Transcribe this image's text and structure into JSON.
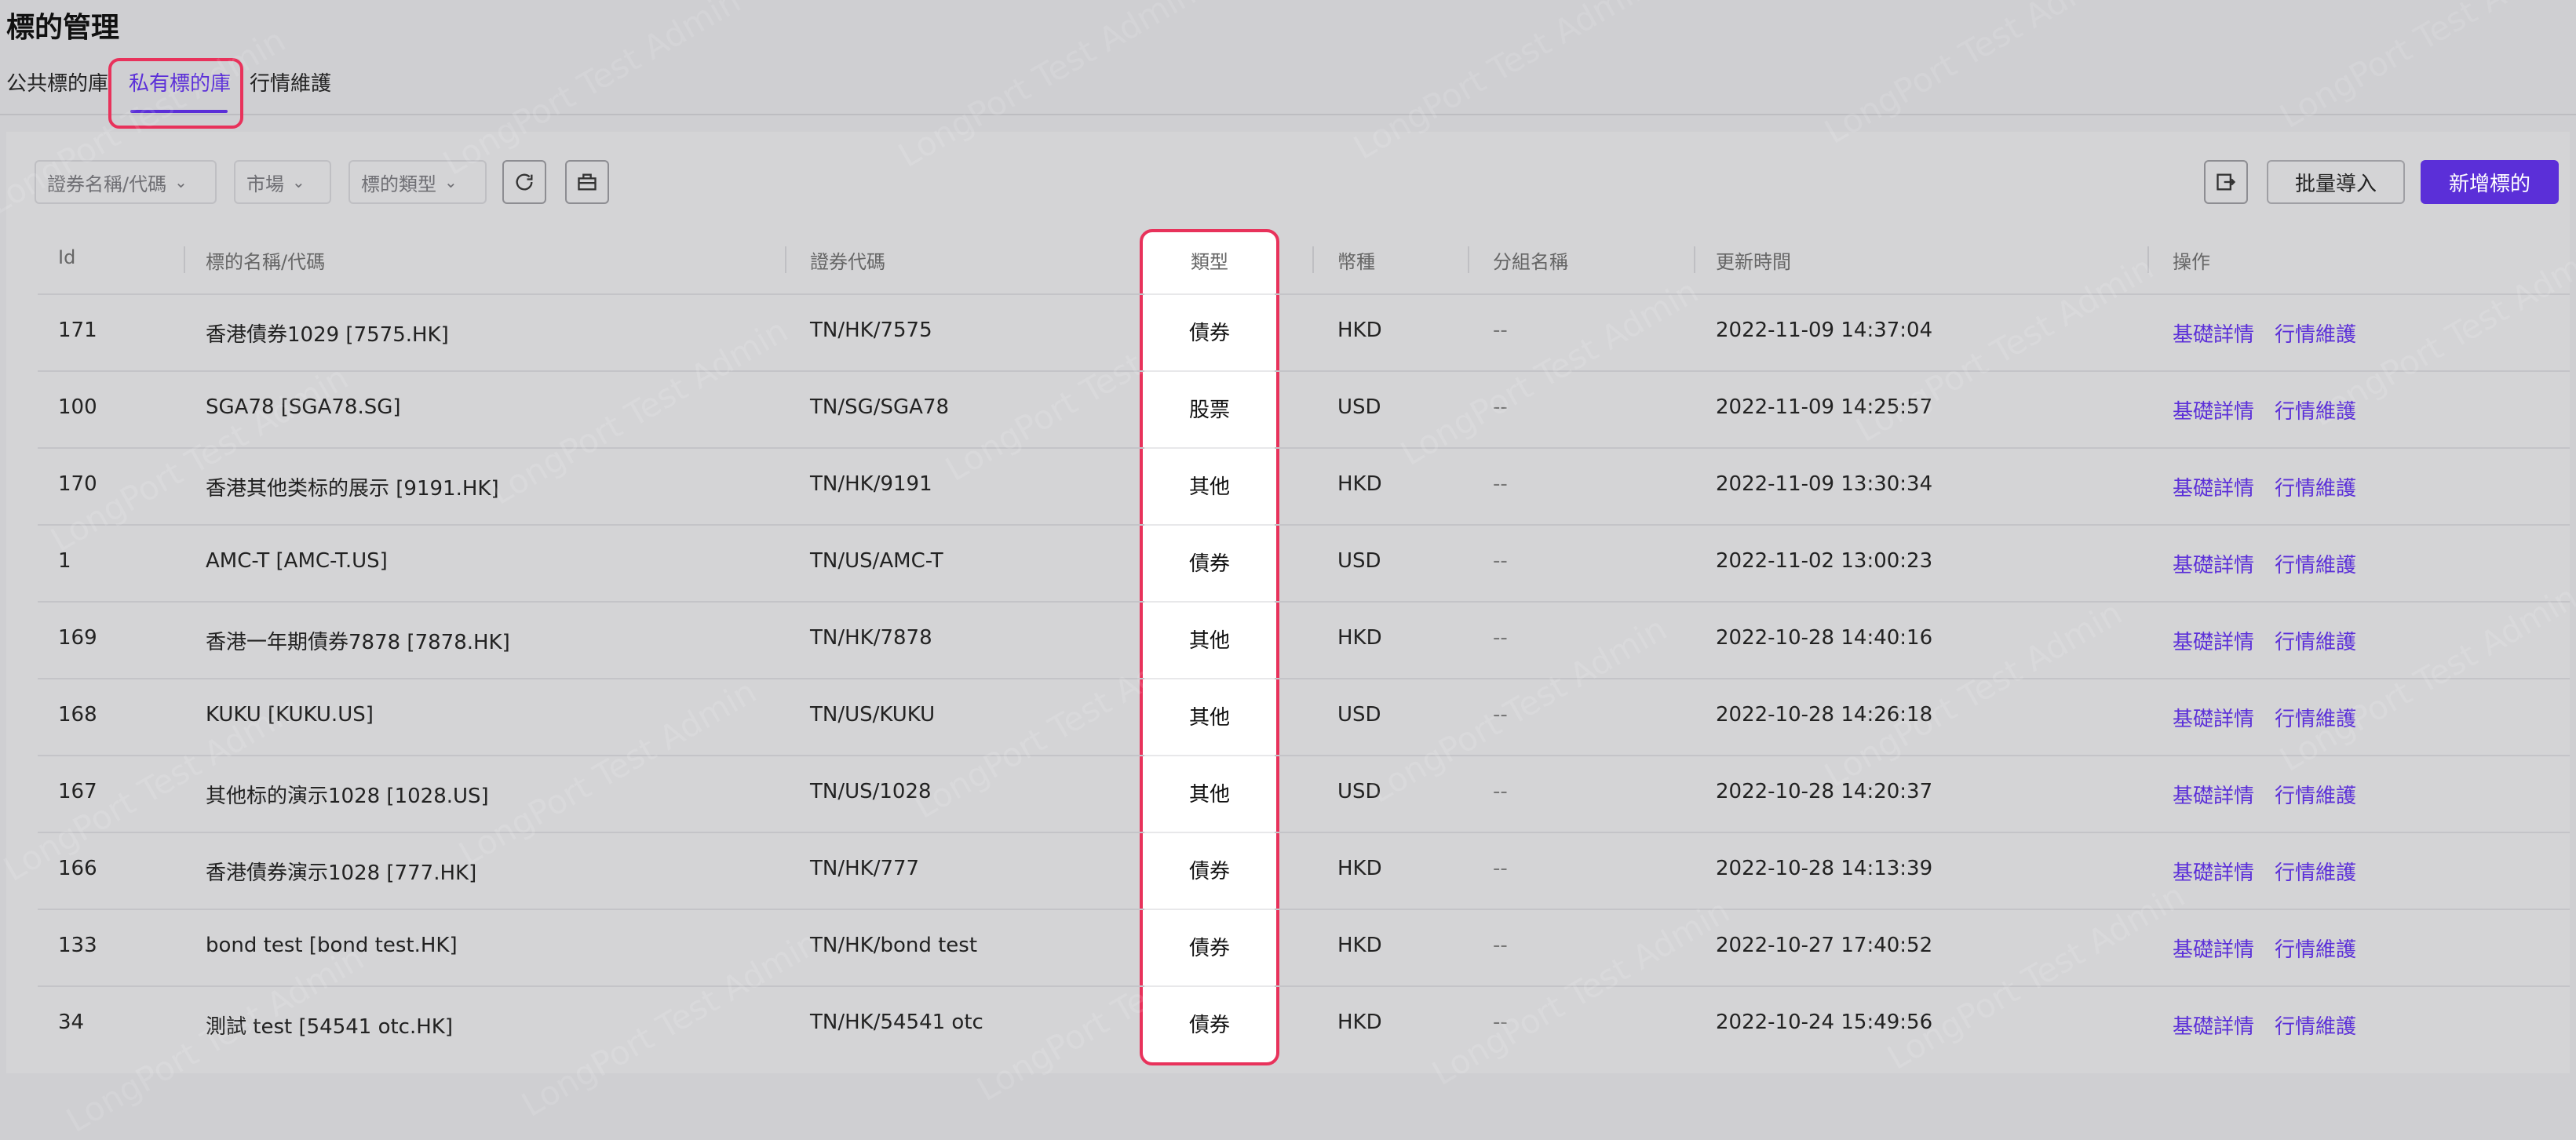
{
  "page": {
    "title": "標的管理"
  },
  "tabs": [
    {
      "label": "公共標的庫"
    },
    {
      "label": "私有標的庫"
    },
    {
      "label": "行情維護"
    }
  ],
  "toolbar": {
    "filter_security": "證券名稱/代碼",
    "filter_market": "市場",
    "filter_type": "標的類型",
    "refresh_icon": "refresh-icon",
    "package_icon": "box-icon",
    "export_icon": "export-icon",
    "batch_import_label": "批量導入",
    "add_label": "新增標的"
  },
  "table": {
    "headers": {
      "id": "Id",
      "name": "標的名稱/代碼",
      "code": "證券代碼",
      "type": "類型",
      "currency": "幣種",
      "group": "分組名稱",
      "updated": "更新時間",
      "actions": "操作"
    },
    "action_labels": {
      "detail": "基礎詳情",
      "quote": "行情維護"
    },
    "rows": [
      {
        "id": "171",
        "name": "香港債券1029 [7575.HK]",
        "code": "TN/HK/7575",
        "type": "債券",
        "currency": "HKD",
        "group": "--",
        "updated": "2022-11-09 14:37:04"
      },
      {
        "id": "100",
        "name": "SGA78 [SGA78.SG]",
        "code": "TN/SG/SGA78",
        "type": "股票",
        "currency": "USD",
        "group": "--",
        "updated": "2022-11-09 14:25:57"
      },
      {
        "id": "170",
        "name": "香港其他类标的展示 [9191.HK]",
        "code": "TN/HK/9191",
        "type": "其他",
        "currency": "HKD",
        "group": "--",
        "updated": "2022-11-09 13:30:34"
      },
      {
        "id": "1",
        "name": "AMC-T [AMC-T.US]",
        "code": "TN/US/AMC-T",
        "type": "債券",
        "currency": "USD",
        "group": "--",
        "updated": "2022-11-02 13:00:23"
      },
      {
        "id": "169",
        "name": "香港一年期債券7878 [7878.HK]",
        "code": "TN/HK/7878",
        "type": "其他",
        "currency": "HKD",
        "group": "--",
        "updated": "2022-10-28 14:40:16"
      },
      {
        "id": "168",
        "name": "KUKU [KUKU.US]",
        "code": "TN/US/KUKU",
        "type": "其他",
        "currency": "USD",
        "group": "--",
        "updated": "2022-10-28 14:26:18"
      },
      {
        "id": "167",
        "name": "其他标的演示1028 [1028.US]",
        "code": "TN/US/1028",
        "type": "其他",
        "currency": "USD",
        "group": "--",
        "updated": "2022-10-28 14:20:37"
      },
      {
        "id": "166",
        "name": "香港債券演示1028 [777.HK]",
        "code": "TN/HK/777",
        "type": "債券",
        "currency": "HKD",
        "group": "--",
        "updated": "2022-10-28 14:13:39"
      },
      {
        "id": "133",
        "name": "bond test [bond test.HK]",
        "code": "TN/HK/bond test",
        "type": "債券",
        "currency": "HKD",
        "group": "--",
        "updated": "2022-10-27 17:40:52"
      },
      {
        "id": "34",
        "name": "測試 test [54541 otc.HK]",
        "code": "TN/HK/54541 otc",
        "type": "債券",
        "currency": "HKD",
        "group": "--",
        "updated": "2022-10-24 15:49:56"
      }
    ]
  },
  "watermark": "LongPort Test Admin",
  "colors": {
    "accent": "#5b2fd8",
    "highlight": "#e8325b"
  }
}
